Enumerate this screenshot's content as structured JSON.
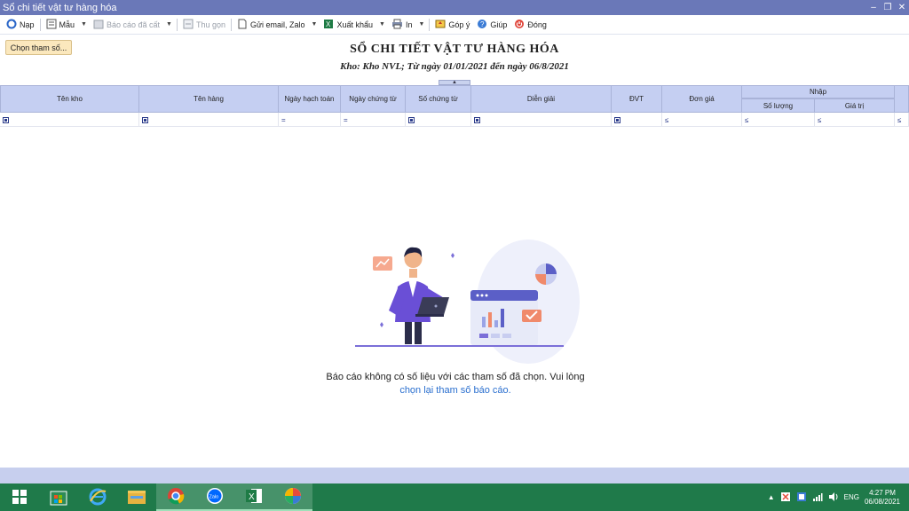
{
  "window": {
    "title": "Sổ chi tiết vật tư hàng hóa"
  },
  "toolbar": {
    "nap": "Nạp",
    "mau": "Mẫu",
    "bao_cao_da_cat": "Báo cáo đã cất",
    "thu_gon": "Thu gọn",
    "gui_email": "Gửi email, Zalo",
    "xuat_khau": "Xuất khẩu",
    "in": "In",
    "gop_y": "Góp ý",
    "giup": "Giúp",
    "dong": "Đóng"
  },
  "params_button": "Chọn tham số...",
  "report": {
    "title": "SỔ CHI TIẾT VẬT TƯ HÀNG HÓA",
    "subtitle": "Kho: Kho NVL; Từ ngày 01/01/2021 đến ngày 06/8/2021"
  },
  "columns": {
    "ten_kho": "Tên kho",
    "ten_hang": "Tên hàng",
    "ngay_hach_toan": "Ngày hạch toán",
    "ngay_chung_tu": "Ngày chứng từ",
    "so_chung_tu": "Số chứng từ",
    "dien_giai": "Diễn giải",
    "dvt": "ĐVT",
    "don_gia": "Đơn giá",
    "nhap": "Nhập",
    "so_luong": "Số lượng",
    "gia_tri": "Giá trị"
  },
  "filter_ops": {
    "eq": "=",
    "le": "≤"
  },
  "empty_state": {
    "message": "Báo cáo không có số liệu với các tham số đã chọn. Vui lòng",
    "link": "chọn lại tham số báo cáo."
  },
  "tray": {
    "lang": "ENG",
    "time": "4:27 PM",
    "date": "06/08/2021"
  },
  "colors": {
    "title_bar": "#6a78b8",
    "header_bg": "#c5cff2",
    "taskbar": "#1f7a4a",
    "link": "#2a6fcf",
    "params_btn": "#fbe8bd"
  }
}
